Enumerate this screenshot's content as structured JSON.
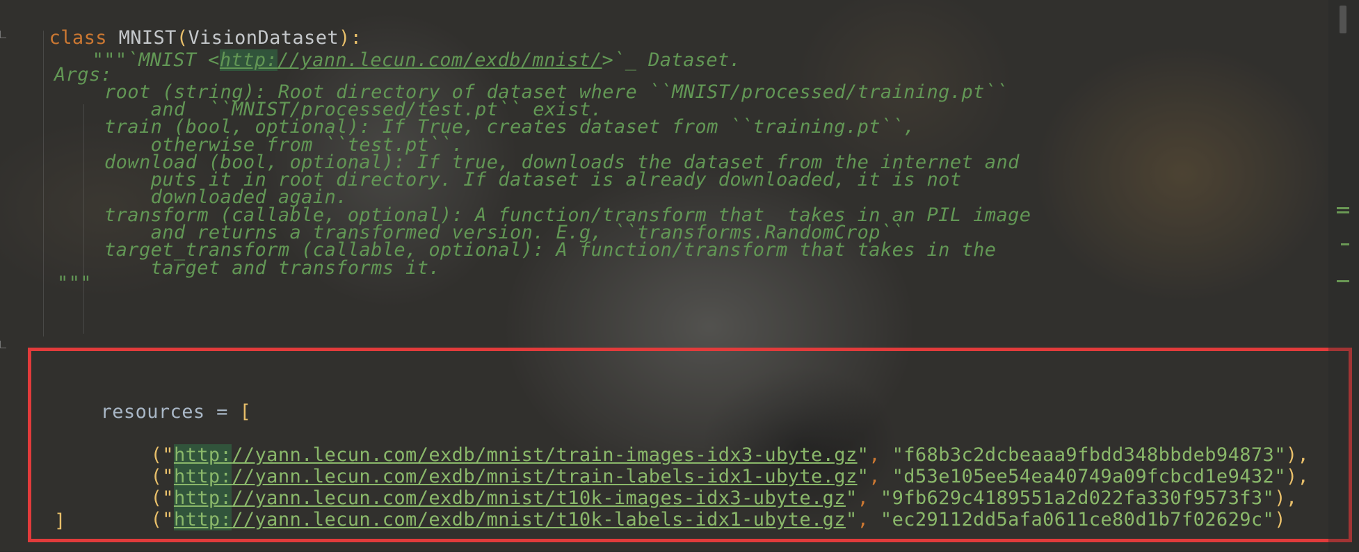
{
  "editor": {
    "class_line": {
      "keyword": "class",
      "name": "MNIST",
      "open_paren": "(",
      "base": "VisionDataset",
      "close": "):"
    },
    "docstring": {
      "line1_prefix": "\"\"\"`MNIST <",
      "line1_url_scheme": "http:",
      "line1_url_rest": "//yann.lecun.com/exdb/mnist/",
      "line1_suffix": ">`_ Dataset.",
      "args_header": "Args:",
      "lines": [
        "root (string): Root directory of dataset where ``MNIST/processed/training.pt``",
        "    and  ``MNIST/processed/test.pt`` exist.",
        "train (bool, optional): If True, creates dataset from ``training.pt``,",
        "    otherwise from ``test.pt``.",
        "download (bool, optional): If true, downloads the dataset from the internet and",
        "    puts it in root directory. If dataset is already downloaded, it is not",
        "    downloaded again.",
        "transform (callable, optional): A function/transform that  takes in an PIL image",
        "    and returns a transformed version. E.g, ``transforms.RandomCrop``",
        "target_transform (callable, optional): A function/transform that takes in the",
        "    target and transforms it."
      ],
      "close": "\"\"\""
    },
    "resources": {
      "name": "resources",
      "assign": " = ",
      "open": "[",
      "close": "]",
      "entries": [
        {
          "scheme": "http:",
          "url_rest": "//yann.lecun.com/exdb/mnist/train-images-idx3-ubyte.gz",
          "md5": "\"f68b3c2dcbeaaa9fbdd348bbdeb94873\"",
          "end": "),"
        },
        {
          "scheme": "http:",
          "url_rest": "//yann.lecun.com/exdb/mnist/train-labels-idx1-ubyte.gz",
          "md5": "\"d53e105ee54ea40749a09fcbcd1e9432\"",
          "end": "),"
        },
        {
          "scheme": "http:",
          "url_rest": "//yann.lecun.com/exdb/mnist/t10k-images-idx3-ubyte.gz",
          "md5": "\"9fb629c4189551a2d022fa330f9573f3\"",
          "end": "),"
        },
        {
          "scheme": "http:",
          "url_rest": "//yann.lecun.com/exdb/mnist/t10k-labels-idx1-ubyte.gz",
          "md5": "\"ec29112dd5afa0611ce80d1b7f02629c\"",
          "end": ")"
        }
      ],
      "entry_open": "(\"",
      "url_close_quote": "\"",
      "separator": ", "
    }
  },
  "colors": {
    "keyword": "#cc7832",
    "docstring": "#629755",
    "string": "#8ab86a",
    "bracket": "#e8bf6a",
    "highlight_box": "#e23b3b"
  }
}
